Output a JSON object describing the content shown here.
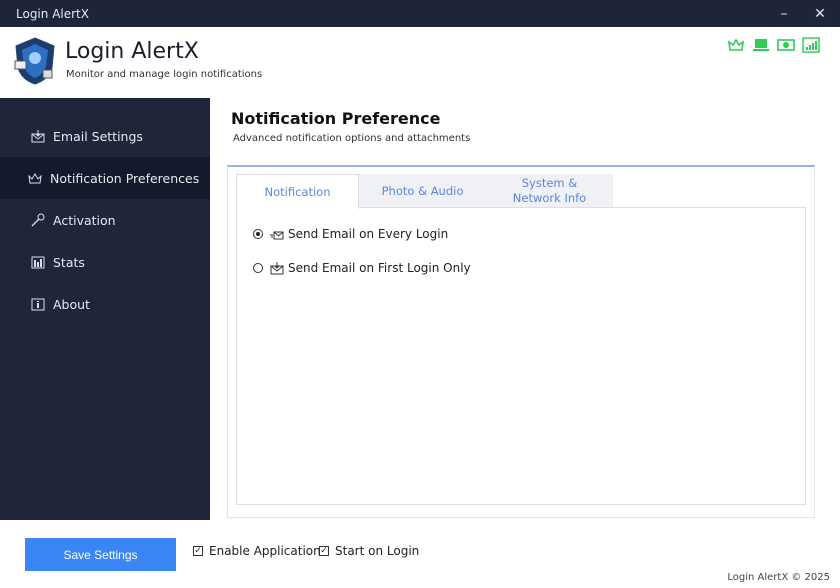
{
  "window": {
    "title": "Login AlertX",
    "minimize": "–",
    "close": "✕"
  },
  "header": {
    "title": "Login AlertX",
    "subtitle": "Monitor and manage login notifications",
    "status_icons": [
      "crown-icon",
      "laptop-icon",
      "money-icon",
      "signal-icon"
    ],
    "accent": "#2ecc55"
  },
  "sidebar": {
    "items": [
      {
        "label": "Email Settings",
        "icon": "email-icon"
      },
      {
        "label": "Notification Preferences",
        "icon": "crown-icon",
        "active": true
      },
      {
        "label": "Activation",
        "icon": "key-icon"
      },
      {
        "label": "Stats",
        "icon": "chart-icon"
      },
      {
        "label": "About",
        "icon": "info-icon"
      }
    ]
  },
  "page": {
    "title": "Notification Preference",
    "subtitle": "Advanced notification options and attachments"
  },
  "tabs": [
    {
      "label": "Notification",
      "active": true
    },
    {
      "label": "Photo & Audio"
    },
    {
      "label": "System & Network Info"
    }
  ],
  "options": [
    {
      "label": "Send Email on Every Login",
      "selected": true
    },
    {
      "label": "Send Email on First Login Only",
      "selected": false
    }
  ],
  "footer": {
    "save": "Save Settings",
    "enable": "Enable Application",
    "enable_checked": true,
    "start": "Start on Login",
    "start_checked": true,
    "copyright": "Login AlertX © 2025"
  },
  "colors": {
    "sidebar": "#1f2639",
    "button": "#3b86f7",
    "tab_text": "#5b86e0"
  }
}
